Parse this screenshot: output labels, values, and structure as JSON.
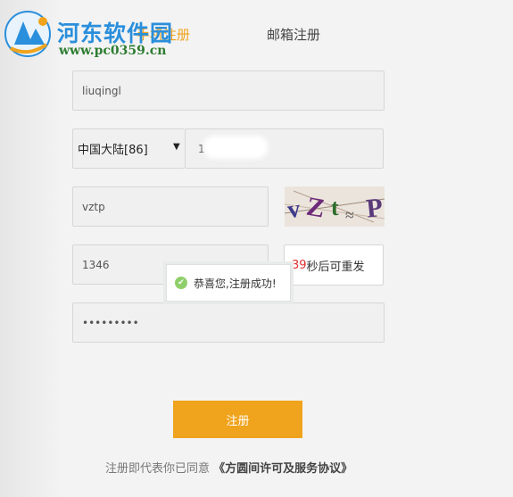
{
  "watermark": {
    "site_name": "河东软件园",
    "url": "www.pc0359.cn"
  },
  "tabs": [
    {
      "label": "手机注册",
      "active": true
    },
    {
      "label": "邮箱注册",
      "active": false
    }
  ],
  "form": {
    "username": "liuqingl",
    "region": "中国大陆[86]",
    "phone_visible_prefix": "1",
    "captcha_input": "vztp",
    "captcha_image_text": "vztp",
    "sms_code": "1346",
    "resend_countdown": "39",
    "resend_suffix": "秒后可重发",
    "password_masked": "•••••••••",
    "submit_label": "注册"
  },
  "toast": {
    "icon": "check-circle-icon",
    "message": "恭喜您,注册成功!"
  },
  "agreement": {
    "prefix": "注册即代表你已同意",
    "link": "《方圆间许可及服务协议》"
  },
  "colors": {
    "accent": "#f0a31c",
    "countdown": "#e03030",
    "success": "#8fcf6b",
    "watermark_blue": "#2a8fdc",
    "watermark_green": "#2e7d32"
  }
}
